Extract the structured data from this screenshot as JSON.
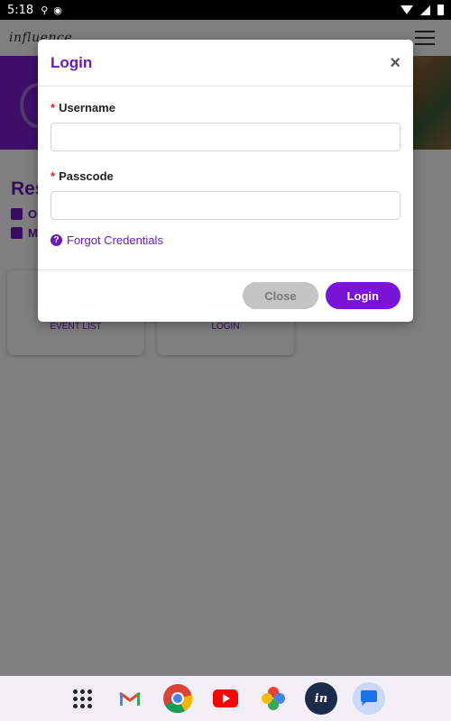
{
  "status_bar": {
    "time": "5:18",
    "left_icons": [
      "usb-icon",
      "notification-icon"
    ],
    "right_icons": [
      "wifi-icon",
      "signal-icon",
      "battery-icon"
    ]
  },
  "app": {
    "logo_text": "influence",
    "event_title": "Res",
    "date_text": "O",
    "location_text": "M",
    "cards": [
      {
        "label": "EVENT LIST"
      },
      {
        "label": "LOGIN"
      }
    ]
  },
  "modal": {
    "title": "Login",
    "close_symbol": "×",
    "required_marker": "*",
    "username_label": "Username",
    "username_value": "",
    "passcode_label": "Passcode",
    "passcode_value": "",
    "forgot_label": "Forgot Credentials",
    "close_button": "Close",
    "login_button": "Login"
  },
  "dock": {
    "items": [
      "app-drawer",
      "Gmail",
      "Chrome",
      "YouTube",
      "Photos",
      "Influence",
      "Messages"
    ],
    "influence_label": "in"
  },
  "colors": {
    "brand_purple": "#7a12d8",
    "required_red": "#e02424"
  }
}
